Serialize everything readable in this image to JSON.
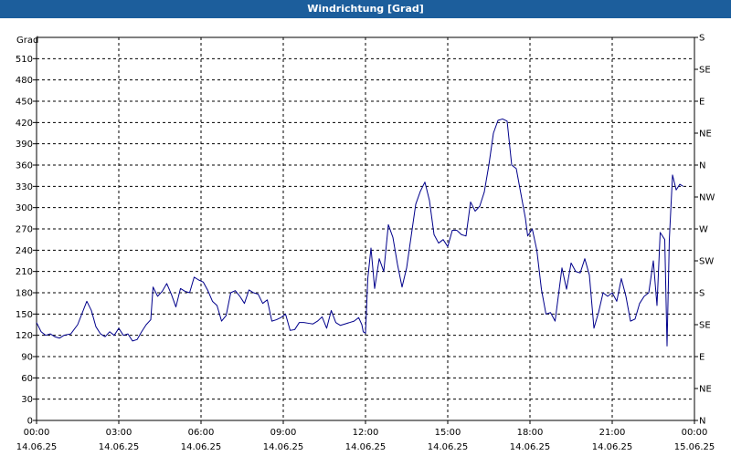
{
  "window": {
    "title": "Windrichtung [Grad]"
  },
  "chart_data": {
    "type": "line",
    "title": "Windrichtung [Grad]",
    "ylabel": "Grad",
    "ylim": [
      0,
      540
    ],
    "xlim": [
      "2025-06-14 00:00",
      "2025-06-15 00:00"
    ],
    "grid": true,
    "y_ticks": [
      0,
      30,
      60,
      90,
      120,
      150,
      180,
      210,
      240,
      270,
      300,
      330,
      360,
      390,
      420,
      450,
      480,
      510
    ],
    "right_axis": {
      "labels": [
        {
          "value": 0,
          "label": "N"
        },
        {
          "value": 45,
          "label": "NE"
        },
        {
          "value": 90,
          "label": "E"
        },
        {
          "value": 135,
          "label": "SE"
        },
        {
          "value": 180,
          "label": "S"
        },
        {
          "value": 225,
          "label": "SW"
        },
        {
          "value": 270,
          "label": "W"
        },
        {
          "value": 315,
          "label": "NW"
        },
        {
          "value": 360,
          "label": "N"
        },
        {
          "value": 405,
          "label": "NE"
        },
        {
          "value": 450,
          "label": "E"
        },
        {
          "value": 495,
          "label": "SE"
        },
        {
          "value": 540,
          "label": "S"
        }
      ]
    },
    "x_ticks": [
      {
        "time": "00:00",
        "date": "14.06.25"
      },
      {
        "time": "03:00",
        "date": "14.06.25"
      },
      {
        "time": "06:00",
        "date": "14.06.25"
      },
      {
        "time": "09:00",
        "date": "14.06.25"
      },
      {
        "time": "12:00",
        "date": "14.06.25"
      },
      {
        "time": "15:00",
        "date": "14.06.25"
      },
      {
        "time": "18:00",
        "date": "14.06.25"
      },
      {
        "time": "21:00",
        "date": "14.06.25"
      },
      {
        "time": "00:00",
        "date": "15.06.25"
      }
    ],
    "series": [
      {
        "color": "#00008b",
        "points": [
          [
            "00:00",
            138
          ],
          [
            "00:10",
            125
          ],
          [
            "00:20",
            120
          ],
          [
            "00:30",
            122
          ],
          [
            "00:40",
            118
          ],
          [
            "00:50",
            116
          ],
          [
            "01:00",
            120
          ],
          [
            "01:15",
            122
          ],
          [
            "01:30",
            135
          ],
          [
            "01:50",
            168
          ],
          [
            "02:00",
            155
          ],
          [
            "02:10",
            132
          ],
          [
            "02:20",
            122
          ],
          [
            "02:30",
            118
          ],
          [
            "02:40",
            125
          ],
          [
            "02:50",
            120
          ],
          [
            "03:00",
            130
          ],
          [
            "03:10",
            120
          ],
          [
            "03:20",
            122
          ],
          [
            "03:30",
            112
          ],
          [
            "03:40",
            114
          ],
          [
            "03:50",
            125
          ],
          [
            "04:00",
            135
          ],
          [
            "04:10",
            142
          ],
          [
            "04:15",
            188
          ],
          [
            "04:25",
            175
          ],
          [
            "04:35",
            182
          ],
          [
            "04:45",
            193
          ],
          [
            "04:55",
            178
          ],
          [
            "05:05",
            160
          ],
          [
            "05:15",
            186
          ],
          [
            "05:25",
            182
          ],
          [
            "05:35",
            180
          ],
          [
            "05:45",
            202
          ],
          [
            "05:55",
            198
          ],
          [
            "06:05",
            195
          ],
          [
            "06:15",
            183
          ],
          [
            "06:25",
            168
          ],
          [
            "06:35",
            162
          ],
          [
            "06:45",
            140
          ],
          [
            "06:55",
            148
          ],
          [
            "07:05",
            180
          ],
          [
            "07:15",
            183
          ],
          [
            "07:25",
            175
          ],
          [
            "07:35",
            165
          ],
          [
            "07:45",
            184
          ],
          [
            "07:55",
            180
          ],
          [
            "08:05",
            178
          ],
          [
            "08:15",
            165
          ],
          [
            "08:25",
            170
          ],
          [
            "08:35",
            140
          ],
          [
            "08:45",
            142
          ],
          [
            "08:55",
            145
          ],
          [
            "09:05",
            150
          ],
          [
            "09:15",
            127
          ],
          [
            "09:25",
            128
          ],
          [
            "09:35",
            138
          ],
          [
            "09:45",
            138
          ],
          [
            "09:55",
            137
          ],
          [
            "10:05",
            136
          ],
          [
            "10:15",
            140
          ],
          [
            "10:25",
            146
          ],
          [
            "10:35",
            130
          ],
          [
            "10:45",
            155
          ],
          [
            "10:55",
            138
          ],
          [
            "11:05",
            134
          ],
          [
            "11:15",
            136
          ],
          [
            "11:25",
            138
          ],
          [
            "11:35",
            140
          ],
          [
            "11:45",
            145
          ],
          [
            "11:52",
            135
          ],
          [
            "11:55",
            125
          ],
          [
            "12:00",
            123
          ],
          [
            "12:05",
            200
          ],
          [
            "12:12",
            243
          ],
          [
            "12:20",
            186
          ],
          [
            "12:30",
            228
          ],
          [
            "12:40",
            210
          ],
          [
            "12:50",
            276
          ],
          [
            "13:00",
            258
          ],
          [
            "13:10",
            220
          ],
          [
            "13:20",
            188
          ],
          [
            "13:30",
            215
          ],
          [
            "13:40",
            260
          ],
          [
            "13:50",
            305
          ],
          [
            "14:00",
            323
          ],
          [
            "14:10",
            336
          ],
          [
            "14:20",
            310
          ],
          [
            "14:30",
            262
          ],
          [
            "14:40",
            250
          ],
          [
            "14:50",
            255
          ],
          [
            "15:00",
            245
          ],
          [
            "15:10",
            268
          ],
          [
            "15:20",
            268
          ],
          [
            "15:30",
            262
          ],
          [
            "15:40",
            260
          ],
          [
            "15:50",
            308
          ],
          [
            "16:00",
            295
          ],
          [
            "16:10",
            302
          ],
          [
            "16:20",
            322
          ],
          [
            "16:30",
            360
          ],
          [
            "16:40",
            405
          ],
          [
            "16:50",
            423
          ],
          [
            "17:00",
            425
          ],
          [
            "17:10",
            422
          ],
          [
            "17:20",
            360
          ],
          [
            "17:30",
            355
          ],
          [
            "17:40",
            320
          ],
          [
            "17:50",
            285
          ],
          [
            "17:55",
            260
          ],
          [
            "18:05",
            270
          ],
          [
            "18:15",
            240
          ],
          [
            "18:25",
            185
          ],
          [
            "18:35",
            150
          ],
          [
            "18:45",
            152
          ],
          [
            "18:55",
            140
          ],
          [
            "19:10",
            215
          ],
          [
            "19:20",
            185
          ],
          [
            "19:30",
            222
          ],
          [
            "19:40",
            210
          ],
          [
            "19:50",
            208
          ],
          [
            "20:00",
            228
          ],
          [
            "20:10",
            205
          ],
          [
            "20:20",
            130
          ],
          [
            "20:30",
            152
          ],
          [
            "20:40",
            180
          ],
          [
            "20:50",
            175
          ],
          [
            "21:00",
            180
          ],
          [
            "21:10",
            168
          ],
          [
            "21:20",
            200
          ],
          [
            "21:30",
            175
          ],
          [
            "21:40",
            140
          ],
          [
            "21:50",
            143
          ],
          [
            "22:00",
            165
          ],
          [
            "22:10",
            175
          ],
          [
            "22:20",
            180
          ],
          [
            "22:30",
            225
          ],
          [
            "22:38",
            162
          ],
          [
            "22:45",
            265
          ],
          [
            "22:55",
            255
          ],
          [
            "23:00",
            105
          ],
          [
            "23:05",
            255
          ],
          [
            "23:12",
            346
          ],
          [
            "23:20",
            325
          ],
          [
            "23:28",
            333
          ],
          [
            "23:35",
            330
          ]
        ]
      }
    ]
  }
}
